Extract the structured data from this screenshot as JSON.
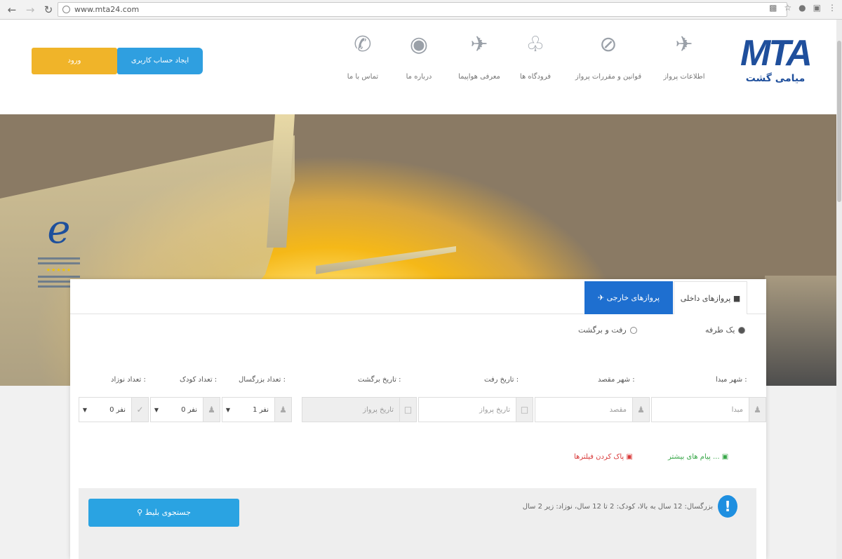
{
  "browser": {
    "url": "www.mta24.com"
  },
  "header": {
    "logo_text": "MTA",
    "logo_sub": "میامی گشت",
    "menu": [
      {
        "label": "اطلاعات پرواز",
        "icon": "plane-landing-icon"
      },
      {
        "label": "قوانین و مقررات پرواز",
        "icon": "no-entry-icon"
      },
      {
        "label": "فرودگاه ها",
        "icon": "control-tower-icon"
      },
      {
        "label": "معرفی هواپیما",
        "icon": "airplane-icon"
      },
      {
        "label": "درباره ما",
        "icon": "info-badge-icon"
      },
      {
        "label": "تماس با ما",
        "icon": "phone-icon"
      }
    ],
    "signup_label": "ایجاد حساب کاربری",
    "login_label": "ورود"
  },
  "enamad": {
    "logo_letter": "e",
    "stars": "★★★★★"
  },
  "search": {
    "tab_foreign": "پروازهای خارجی",
    "tab_domestic": "پروازهای داخلی",
    "trip_one_way": "یک طرفه",
    "trip_round": "رفت و برگشت",
    "labels": {
      "origin": "شهر مبدا :",
      "destination": "شهر مقصد :",
      "depart_date": "تاریخ رفت :",
      "return_date": "تاریخ برگشت :",
      "adults": "تعداد بزرگسال :",
      "children": "تعداد کودک :",
      "infants": "تعداد نوزاد :"
    },
    "fields": {
      "origin_placeholder": "مبدا",
      "destination_placeholder": "مقصد",
      "depart_placeholder": "تاریخ پرواز",
      "return_placeholder": "تاریخ پرواز",
      "adults_value": "1 نفر",
      "children_value": "0 نفر",
      "infants_value": "0 نفر"
    },
    "link_more": "پیام های بیشتر ...",
    "link_clear": "پاک کردن فیلترها",
    "note": "بزرگسال: 12 سال به بالا، کودک: 2 تا 12 سال، نوزاد: زیر 2 سال",
    "submit_label": "جستجوی بلیط"
  }
}
